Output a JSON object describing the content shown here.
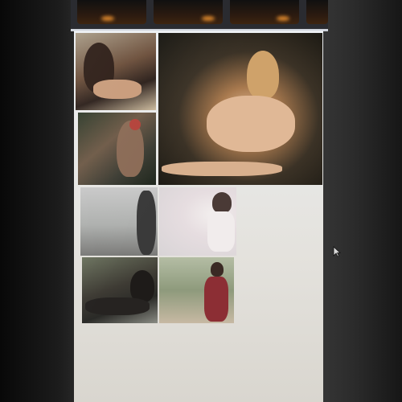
{
  "gallery": {
    "top_thumbnails": [
      {
        "name": "thumbnail-1"
      },
      {
        "name": "thumbnail-2"
      },
      {
        "name": "thumbnail-3"
      },
      {
        "name": "thumbnail-4"
      }
    ],
    "photos": [
      {
        "name": "photo-woman-sunglasses-beach"
      },
      {
        "name": "photo-woman-lounging-couch"
      },
      {
        "name": "photo-woman-headdress"
      },
      {
        "name": "photo-woman-standing-gray"
      },
      {
        "name": "photo-woman-white-dress"
      },
      {
        "name": "photo-woman-reclining-dark"
      },
      {
        "name": "photo-woman-red-dress"
      }
    ]
  },
  "icons": {
    "cursor": "mouse-pointer-icon"
  },
  "colors": {
    "panel_background": "#e6e6e4",
    "top_strip": "#2a2b30",
    "right_margin": "#2e2e2e"
  }
}
